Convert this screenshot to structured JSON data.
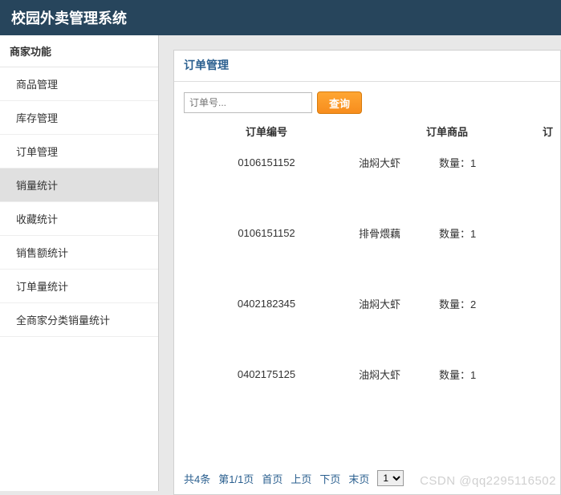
{
  "header": {
    "title": "校园外卖管理系统"
  },
  "sidebar": {
    "header": "商家功能",
    "items": [
      {
        "label": "商品管理"
      },
      {
        "label": "库存管理"
      },
      {
        "label": "订单管理"
      },
      {
        "label": "销量统计",
        "active": true
      },
      {
        "label": "收藏统计"
      },
      {
        "label": "销售额统计"
      },
      {
        "label": "订单量统计"
      },
      {
        "label": "全商家分类销量统计"
      }
    ]
  },
  "panel": {
    "title": "订单管理",
    "search_placeholder": "订单号...",
    "search_btn": "查询",
    "columns": {
      "c1": "订单编号",
      "c2": "订单商品",
      "c3": "订"
    },
    "rows": [
      {
        "orderNo": "0106151152",
        "product": "油焖大虾",
        "qty": "数量：1"
      },
      {
        "orderNo": "0106151152",
        "product": "排骨煨藕",
        "qty": "数量：1"
      },
      {
        "orderNo": "0402182345",
        "product": "油焖大虾",
        "qty": "数量：2"
      },
      {
        "orderNo": "0402175125",
        "product": "油焖大虾",
        "qty": "数量：1"
      }
    ],
    "pager": {
      "total": "共4条",
      "page": "第1/1页",
      "first": "首页",
      "prev": "上页",
      "next": "下页",
      "last": "末页",
      "select": "1"
    }
  },
  "watermark": "CSDN @qq2295116502"
}
